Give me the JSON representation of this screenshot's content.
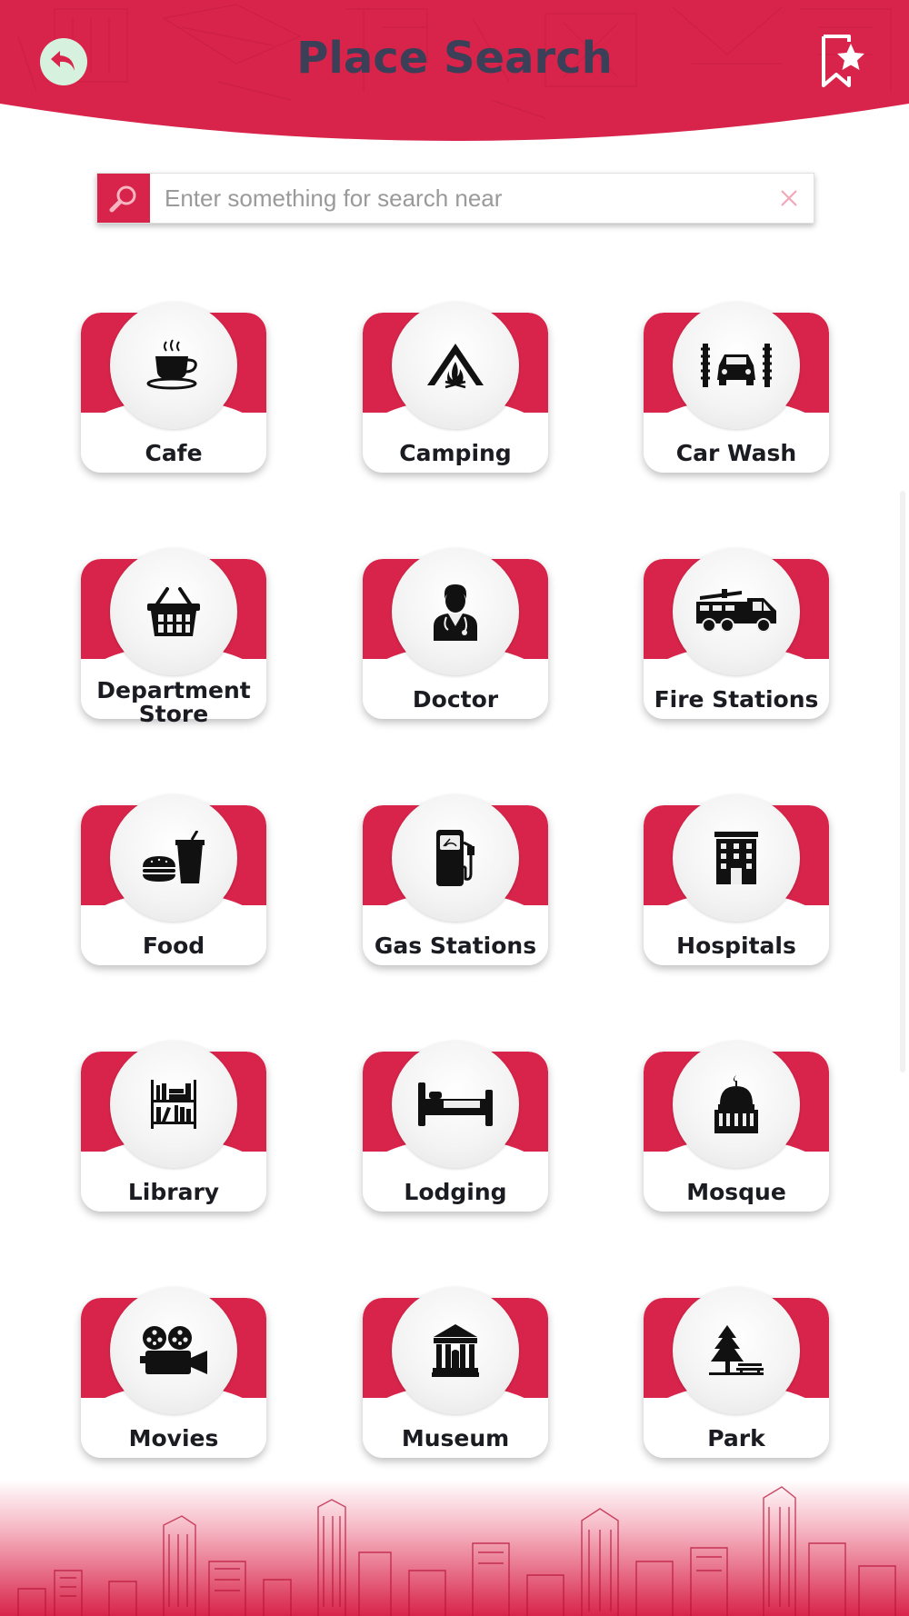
{
  "header": {
    "title": "Place Search",
    "back_icon": "back-arrow-icon",
    "bookmark_icon": "bookmark-star-icon"
  },
  "search": {
    "placeholder": "Enter something for search near",
    "value": "",
    "search_icon": "magnifier-icon",
    "clear_icon": "close-icon"
  },
  "colors": {
    "brand_red": "#d8244a",
    "title_dark": "#3c3f58",
    "back_button_bg": "#d6f2df"
  },
  "categories": [
    {
      "label": "Cafe",
      "icon": "coffee-cup-icon"
    },
    {
      "label": "Camping",
      "icon": "tent-icon"
    },
    {
      "label": "Car Wash",
      "icon": "car-wash-icon"
    },
    {
      "label": "Department Store",
      "label_line1": "Department",
      "label_line2": "Store",
      "icon": "basket-icon"
    },
    {
      "label": "Doctor",
      "icon": "doctor-icon"
    },
    {
      "label": "Fire Stations",
      "icon": "fire-truck-icon"
    },
    {
      "label": "Food",
      "icon": "burger-drink-icon"
    },
    {
      "label": "Gas Stations",
      "icon": "fuel-pump-icon"
    },
    {
      "label": "Hospitals",
      "icon": "hospital-building-icon"
    },
    {
      "label": "Library",
      "icon": "bookshelf-icon"
    },
    {
      "label": "Lodging",
      "icon": "bed-icon"
    },
    {
      "label": "Mosque",
      "icon": "mosque-icon"
    },
    {
      "label": "Movies",
      "icon": "film-camera-icon"
    },
    {
      "label": "Museum",
      "icon": "museum-icon"
    },
    {
      "label": "Park",
      "icon": "tree-bench-icon"
    }
  ]
}
